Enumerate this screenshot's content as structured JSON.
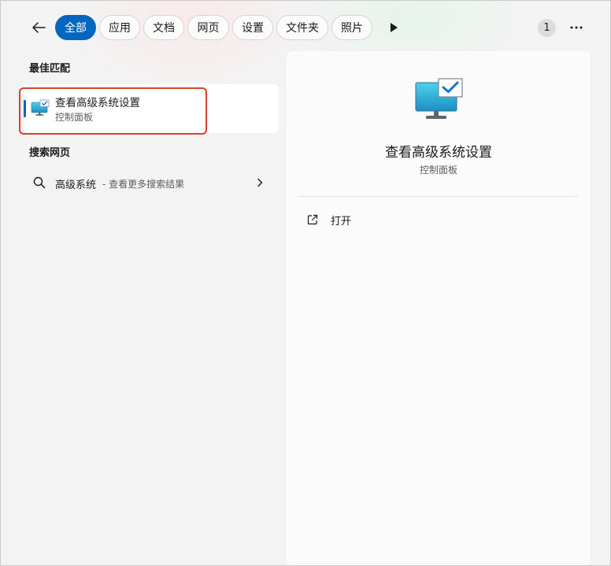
{
  "filters": {
    "back_icon": "back-arrow-icon",
    "tabs": [
      {
        "label": "全部",
        "active": true
      },
      {
        "label": "应用",
        "active": false
      },
      {
        "label": "文档",
        "active": false
      },
      {
        "label": "网页",
        "active": false
      },
      {
        "label": "设置",
        "active": false
      },
      {
        "label": "文件夹",
        "active": false
      },
      {
        "label": "照片",
        "active": false
      }
    ],
    "play_icon": "play-icon",
    "count": "1",
    "more_icon": "more-icon"
  },
  "best_match": {
    "heading": "最佳匹配",
    "item": {
      "title": "查看高级系统设置",
      "subtitle": "控制面板",
      "icon": "monitor-check-icon"
    }
  },
  "web_search": {
    "heading": "搜索网页",
    "query": "高级系统",
    "hint": "- 查看更多搜索结果",
    "icon": "search-icon",
    "chevron": "chevron-right-icon"
  },
  "detail": {
    "title": "查看高级系统设置",
    "subtitle": "控制面板",
    "icon": "monitor-check-icon",
    "actions": [
      {
        "label": "打开",
        "icon": "open-external-icon"
      }
    ]
  },
  "colors": {
    "accent": "#0067c0",
    "highlight_border": "#d9412c",
    "panel": "#fbfbfb",
    "background": "#f3f3f3"
  }
}
